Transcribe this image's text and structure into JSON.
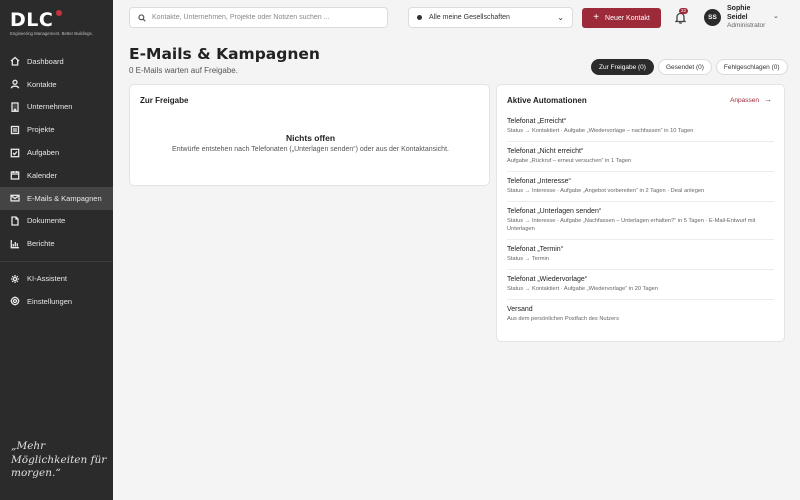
{
  "brand": {
    "logo": "DLC",
    "tagline": "Engineering Management. Better Buildings.",
    "accent": "#9c2a38",
    "quote": "„Mehr Möglichkeiten für morgen.“"
  },
  "sidebar": {
    "items": [
      {
        "label": "Dashboard",
        "icon": "home-icon"
      },
      {
        "label": "Kontakte",
        "icon": "user-icon"
      },
      {
        "label": "Unternehmen",
        "icon": "building-icon"
      },
      {
        "label": "Projekte",
        "icon": "folder-icon"
      },
      {
        "label": "Aufgaben",
        "icon": "checkbox-icon"
      },
      {
        "label": "Kalender",
        "icon": "calendar-icon"
      },
      {
        "label": "E-Mails & Kampagnen",
        "icon": "mail-icon",
        "active": true
      },
      {
        "label": "Dokumente",
        "icon": "document-icon"
      },
      {
        "label": "Berichte",
        "icon": "chart-icon"
      }
    ],
    "secondary": [
      {
        "label": "KI-Assistent",
        "icon": "sparkle-icon"
      },
      {
        "label": "Einstellungen",
        "icon": "gear-icon"
      }
    ]
  },
  "topbar": {
    "search_placeholder": "Kontakte, Unternehmen, Projekte oder Notizen suchen ...",
    "company_select": "Alle meine Gesellschaften",
    "new_contact": "Neuer Kontakt",
    "notifications_count": "22",
    "user": {
      "initials": "SS",
      "name": "Sophie Seidel",
      "role": "Administrator"
    }
  },
  "page": {
    "title": "E-Mails & Kampagnen",
    "subtitle": "0 E-Mails warten auf Freigabe.",
    "filters": [
      "Zur Freigabe (0)",
      "Gesendet (0)",
      "Fehlgeschlagen (0)"
    ],
    "active_filter": 0
  },
  "release_card": {
    "heading": "Zur Freigabe",
    "empty_title": "Nichts offen",
    "empty_text": "Entwürfe entstehen nach Telefonaten („Unterlagen senden“) oder aus der Kontaktansicht."
  },
  "automations_card": {
    "heading": "Aktive Automationen",
    "adjust_label": "Anpassen",
    "items": [
      {
        "name": "Telefonat „Erreicht“",
        "desc": "Status → Kontaktiert · Aufgabe „Wiedervorlage – nachfassen“ in 10 Tagen"
      },
      {
        "name": "Telefonat „Nicht erreicht“",
        "desc": "Aufgabe „Rückruf – erneut versuchen“ in 1 Tagen"
      },
      {
        "name": "Telefonat „Interesse“",
        "desc": "Status → Interesse · Aufgabe „Angebot vorbereiten“ in 2 Tagen · Deal anlegen"
      },
      {
        "name": "Telefonat „Unterlagen senden“",
        "desc": "Status → Interesse · Aufgabe „Nachfassen – Unterlagen erhalten?“ in 5 Tagen · E-Mail-Entwurf mit Unterlagen"
      },
      {
        "name": "Telefonat „Termin“",
        "desc": "Status → Termin"
      },
      {
        "name": "Telefonat „Wiedervorlage“",
        "desc": "Status → Kontaktiert · Aufgabe „Wiedervorlage“ in 20 Tagen"
      },
      {
        "name": "Versand",
        "desc": "Aus dem persönlichen Postfach des Nutzers"
      }
    ]
  }
}
